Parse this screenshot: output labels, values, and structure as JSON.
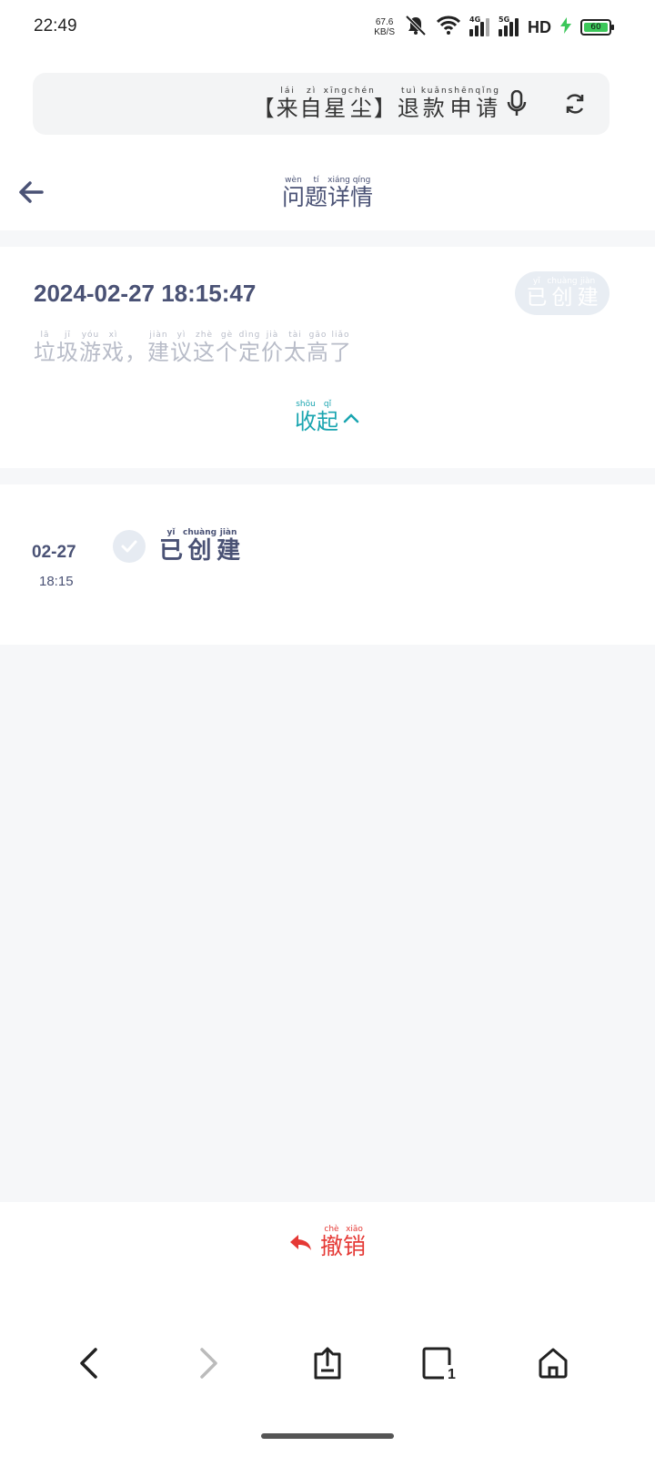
{
  "status_bar": {
    "time": "22:49",
    "net_speed_value": "67.6",
    "net_speed_unit": "KB/S",
    "signal_1_label": "4G",
    "signal_2_label": "5G",
    "hd_label": "HD",
    "battery_level": "60",
    "icons": [
      "mute-icon",
      "wifi-icon",
      "signal-icon",
      "charging-icon",
      "battery-icon"
    ]
  },
  "url_bar": {
    "title_prefix": "【",
    "title_suffix": "】",
    "title_group1": [
      {
        "char": "来",
        "pinyin": "lái"
      },
      {
        "char": "自",
        "pinyin": "zì"
      },
      {
        "char": "星",
        "pinyin": "xīng"
      },
      {
        "char": "尘",
        "pinyin": "chén"
      }
    ],
    "title_group2": [
      {
        "char": "退",
        "pinyin": "tuì"
      },
      {
        "char": "款",
        "pinyin": "kuǎn"
      },
      {
        "char": "申",
        "pinyin": "shēn"
      },
      {
        "char": "请",
        "pinyin": "qǐng"
      }
    ],
    "icons": [
      "microphone-icon",
      "refresh-icon"
    ]
  },
  "header": {
    "title": [
      {
        "char": "问",
        "pinyin": "wèn"
      },
      {
        "char": "题",
        "pinyin": "tí"
      },
      {
        "char": "详",
        "pinyin": "xiáng"
      },
      {
        "char": "情",
        "pinyin": "qíng"
      }
    ]
  },
  "detail": {
    "datetime": "2024-02-27 18:15:47",
    "status": [
      {
        "char": "已",
        "pinyin": "yǐ"
      },
      {
        "char": "创",
        "pinyin": "chuàng"
      },
      {
        "char": "建",
        "pinyin": "jiàn"
      }
    ],
    "description": [
      {
        "char": "垃",
        "pinyin": "lā"
      },
      {
        "char": "圾",
        "pinyin": "jī"
      },
      {
        "char": "游",
        "pinyin": "yóu"
      },
      {
        "char": "戏",
        "pinyin": "xì"
      },
      {
        "char": "，",
        "pinyin": ""
      },
      {
        "char": "建",
        "pinyin": "jiàn"
      },
      {
        "char": "议",
        "pinyin": "yì"
      },
      {
        "char": "这",
        "pinyin": "zhè"
      },
      {
        "char": "个",
        "pinyin": "gè"
      },
      {
        "char": "定",
        "pinyin": "dìng"
      },
      {
        "char": "价",
        "pinyin": "jià"
      },
      {
        "char": "太",
        "pinyin": "tài"
      },
      {
        "char": "高",
        "pinyin": "gāo"
      },
      {
        "char": "了",
        "pinyin": "liǎo"
      }
    ],
    "collapse_label": [
      {
        "char": "收",
        "pinyin": "shōu"
      },
      {
        "char": "起",
        "pinyin": "qǐ"
      }
    ]
  },
  "timeline": {
    "date": "02-27",
    "time": "18:15",
    "status": [
      {
        "char": "已",
        "pinyin": "yǐ"
      },
      {
        "char": "创",
        "pinyin": "chuàng"
      },
      {
        "char": "建",
        "pinyin": "jiàn"
      }
    ]
  },
  "footer": {
    "revoke_label": [
      {
        "char": "撤",
        "pinyin": "chè"
      },
      {
        "char": "销",
        "pinyin": "xiāo"
      }
    ]
  },
  "bottom_nav": {
    "tab_count": "1",
    "items": [
      "back-arrow-icon",
      "forward-arrow-icon",
      "share-icon",
      "tabs-icon",
      "home-icon"
    ]
  },
  "colors": {
    "primary_text": "#4a5275",
    "accent_teal": "#1aa5b0",
    "danger_red": "#e53935",
    "muted_text": "#b8bcc8",
    "page_bg": "#f6f7f9"
  }
}
